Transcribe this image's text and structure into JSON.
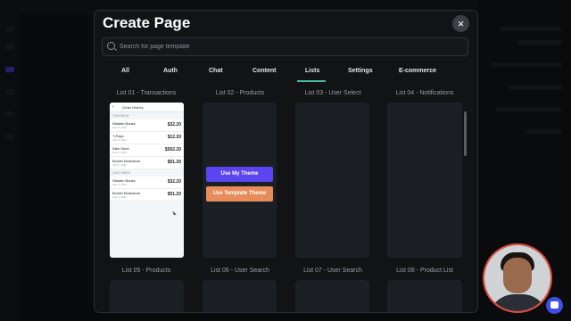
{
  "modal": {
    "title": "Create Page",
    "close_icon": "×",
    "search_placeholder": "Search for page template"
  },
  "tabs": [
    {
      "label": "All"
    },
    {
      "label": "Auth"
    },
    {
      "label": "Chat"
    },
    {
      "label": "Content"
    },
    {
      "label": "Lists",
      "active": true
    },
    {
      "label": "Settings"
    },
    {
      "label": "E-commerce"
    }
  ],
  "cards": [
    {
      "title": "List 01 - Transactions"
    },
    {
      "title": "List 02 - Products"
    },
    {
      "title": "List 03 - User Select"
    },
    {
      "title": "List 04 - Notifications"
    },
    {
      "title": "List 05 - Products"
    },
    {
      "title": "List 06 - User Search"
    },
    {
      "title": "List 07 - User Search"
    },
    {
      "title": "List 08 - Product List"
    }
  ],
  "preview": {
    "header": "Order History",
    "section1": "THURSDAY",
    "section2": "LAST WEEK",
    "rows": [
      {
        "name": "Walden Books",
        "date": "Feb 8, 2022",
        "price": "$32.20"
      },
      {
        "name": "T-Pays",
        "date": "Feb 8, 2022",
        "price": "$12.20"
      },
      {
        "name": "Nike Store",
        "date": "Feb 8, 2022",
        "price": "$552.20"
      },
      {
        "name": "Border Bookstore",
        "date": "Feb 8, 2022",
        "price": "$51.20"
      },
      {
        "name": "Walden Books",
        "date": "Feb 8, 2022",
        "price": "$32.20"
      },
      {
        "name": "Border Bookstore",
        "date": "Feb 8, 2022",
        "price": "$51.20"
      }
    ]
  },
  "buttons": {
    "use_my_theme": "Use My Theme",
    "use_template_theme": "Use Template Theme"
  },
  "colors": {
    "accent_tab": "#3fbfa6",
    "primary_button": "#5a45f0",
    "secondary_button": "#e98c5b"
  }
}
